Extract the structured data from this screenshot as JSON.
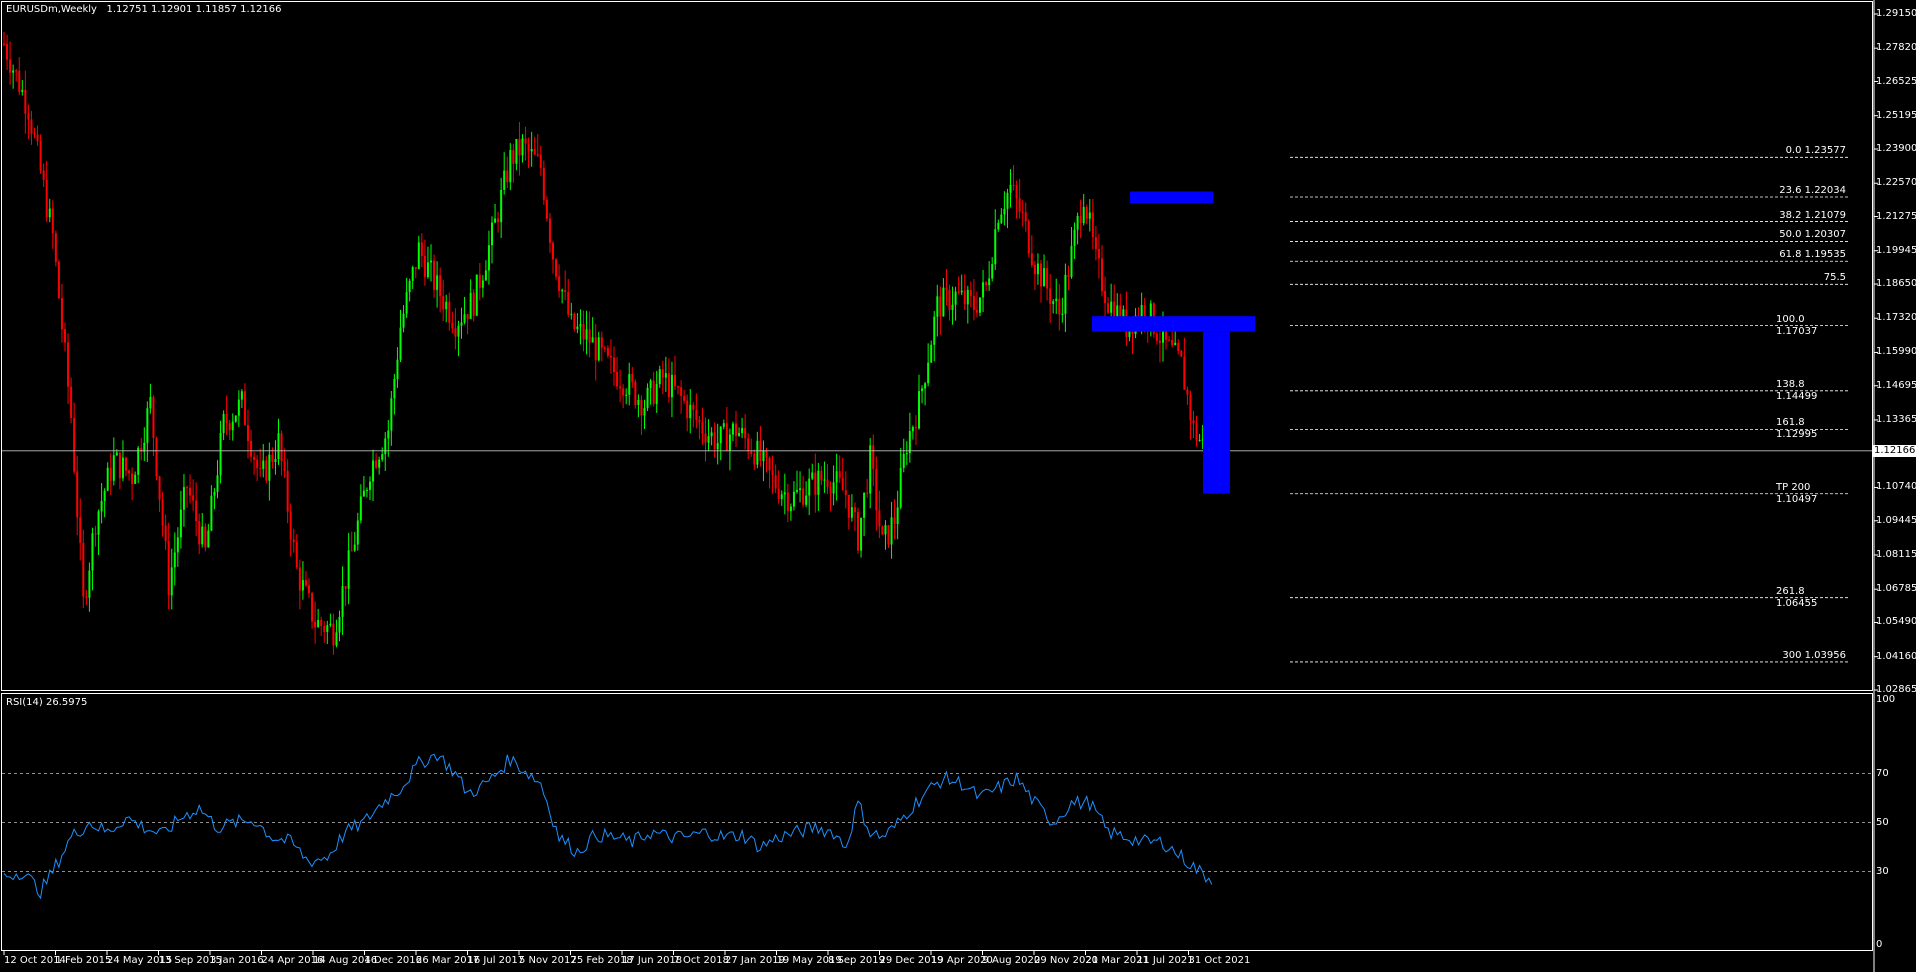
{
  "header": {
    "symbol": "EURUSDm,Weekly",
    "ohlc": "1.12751 1.12901 1.11857 1.12166"
  },
  "rsi_header": "RSI(14) 26.5975",
  "colors": {
    "background": "#000000",
    "bull_candle": "#00ff00",
    "bear_candle": "#ff0000",
    "rsi_line": "#1e90ff",
    "fib_line": "#ffffff",
    "zone": "#0000ff"
  },
  "price_axis": [
    "1.29150",
    "1.27820",
    "1.26525",
    "1.25195",
    "1.23900",
    "1.22570",
    "1.21275",
    "1.19945",
    "1.18650",
    "1.17320",
    "1.15990",
    "1.14695",
    "1.13365",
    "1.10740",
    "1.09445",
    "1.08115",
    "1.06785",
    "1.05490",
    "1.04160",
    "1.02865"
  ],
  "current_price": "1.12166",
  "fib_levels": [
    {
      "label": "0.0 1.23577",
      "price": 1.23577
    },
    {
      "label": "23.6 1.22034",
      "price": 1.22034
    },
    {
      "label": "38.2 1.21079",
      "price": 1.21079
    },
    {
      "label": "50.0 1.20307",
      "price": 1.20307
    },
    {
      "label": "61.8 1.19535",
      "price": 1.19535
    },
    {
      "label": "75.5",
      "price": 1.1864
    },
    {
      "label": "100.0 1.17037",
      "price": 1.17037
    },
    {
      "label": "138.8 1.14499",
      "price": 1.14499
    },
    {
      "label": "161.8 1.12995",
      "price": 1.12995
    },
    {
      "label": "TP 200 1.10497",
      "price": 1.10497
    },
    {
      "label": "261.8 1.06455",
      "price": 1.06455
    },
    {
      "label": "300 1.03956",
      "price": 1.03956
    }
  ],
  "rsi_axis": [
    "100",
    "70",
    "50",
    "30",
    "0"
  ],
  "date_axis": [
    "12 Oct 2014",
    "1 Feb 2015",
    "24 May 2015",
    "13 Sep 2015",
    "3 Jan 2016",
    "24 Apr 2016",
    "14 Aug 2016",
    "4 Dec 2016",
    "26 Mar 2017",
    "16 Jul 2017",
    "5 Nov 2017",
    "25 Feb 2018",
    "17 Jun 2018",
    "7 Oct 2018",
    "27 Jan 2019",
    "19 May 2019",
    "8 Sep 2019",
    "29 Dec 2019",
    "19 Apr 2020",
    "9 Aug 2020",
    "29 Nov 2020",
    "21 Mar 2021",
    "11 Jul 2021",
    "31 Oct 2021"
  ],
  "chart_data": {
    "type": "candlestick",
    "timeframe": "weekly",
    "ylim": [
      1.02865,
      1.2915
    ],
    "series_key": [
      [
        0,
        1.28
      ],
      [
        8,
        1.255
      ],
      [
        16,
        1.205
      ],
      [
        22,
        1.135
      ],
      [
        26,
        1.062
      ],
      [
        30,
        1.095
      ],
      [
        36,
        1.118
      ],
      [
        42,
        1.112
      ],
      [
        48,
        1.14
      ],
      [
        54,
        1.07
      ],
      [
        60,
        1.108
      ],
      [
        66,
        1.082
      ],
      [
        72,
        1.132
      ],
      [
        78,
        1.14
      ],
      [
        84,
        1.11
      ],
      [
        90,
        1.125
      ],
      [
        96,
        1.075
      ],
      [
        102,
        1.055
      ],
      [
        108,
        1.052
      ],
      [
        114,
        1.082
      ],
      [
        120,
        1.115
      ],
      [
        126,
        1.13
      ],
      [
        130,
        1.17
      ],
      [
        136,
        1.2
      ],
      [
        142,
        1.185
      ],
      [
        148,
        1.172
      ],
      [
        154,
        1.18
      ],
      [
        160,
        1.205
      ],
      [
        166,
        1.235
      ],
      [
        170,
        1.24
      ],
      [
        176,
        1.232
      ],
      [
        180,
        1.198
      ],
      [
        186,
        1.17
      ],
      [
        192,
        1.165
      ],
      [
        198,
        1.155
      ],
      [
        204,
        1.148
      ],
      [
        210,
        1.14
      ],
      [
        216,
        1.15
      ],
      [
        222,
        1.142
      ],
      [
        228,
        1.132
      ],
      [
        234,
        1.125
      ],
      [
        240,
        1.13
      ],
      [
        246,
        1.122
      ],
      [
        252,
        1.11
      ],
      [
        258,
        1.103
      ],
      [
        264,
        1.108
      ],
      [
        270,
        1.112
      ],
      [
        276,
        1.105
      ],
      [
        280,
        1.088
      ],
      [
        284,
        1.118
      ],
      [
        288,
        1.085
      ],
      [
        292,
        1.095
      ],
      [
        296,
        1.125
      ],
      [
        300,
        1.14
      ],
      [
        306,
        1.178
      ],
      [
        312,
        1.182
      ],
      [
        318,
        1.178
      ],
      [
        322,
        1.185
      ],
      [
        326,
        1.215
      ],
      [
        330,
        1.224
      ],
      [
        334,
        1.212
      ],
      [
        338,
        1.195
      ],
      [
        342,
        1.185
      ],
      [
        346,
        1.175
      ],
      [
        350,
        1.198
      ],
      [
        354,
        1.222
      ],
      [
        358,
        1.195
      ],
      [
        362,
        1.18
      ],
      [
        368,
        1.17
      ],
      [
        374,
        1.178
      ],
      [
        380,
        1.164
      ],
      [
        386,
        1.155
      ],
      [
        390,
        1.13
      ],
      [
        394,
        1.122
      ]
    ],
    "rsi_key": [
      [
        0,
        28
      ],
      [
        6,
        30
      ],
      [
        12,
        22
      ],
      [
        16,
        30
      ],
      [
        22,
        44
      ],
      [
        28,
        50
      ],
      [
        34,
        46
      ],
      [
        40,
        52
      ],
      [
        46,
        48
      ],
      [
        52,
        45
      ],
      [
        58,
        52
      ],
      [
        64,
        56
      ],
      [
        70,
        48
      ],
      [
        76,
        50
      ],
      [
        82,
        51
      ],
      [
        88,
        44
      ],
      [
        94,
        42
      ],
      [
        100,
        34
      ],
      [
        106,
        36
      ],
      [
        112,
        46
      ],
      [
        118,
        50
      ],
      [
        124,
        58
      ],
      [
        130,
        64
      ],
      [
        136,
        74
      ],
      [
        142,
        78
      ],
      [
        148,
        70
      ],
      [
        152,
        62
      ],
      [
        156,
        64
      ],
      [
        160,
        68
      ],
      [
        166,
        76
      ],
      [
        170,
        72
      ],
      [
        176,
        66
      ],
      [
        182,
        44
      ],
      [
        188,
        38
      ],
      [
        194,
        45
      ],
      [
        200,
        44
      ],
      [
        206,
        42
      ],
      [
        212,
        46
      ],
      [
        218,
        44
      ],
      [
        224,
        44
      ],
      [
        230,
        46
      ],
      [
        236,
        44
      ],
      [
        242,
        45
      ],
      [
        248,
        40
      ],
      [
        254,
        44
      ],
      [
        260,
        46
      ],
      [
        266,
        48
      ],
      [
        272,
        46
      ],
      [
        276,
        40
      ],
      [
        280,
        58
      ],
      [
        284,
        46
      ],
      [
        288,
        44
      ],
      [
        292,
        48
      ],
      [
        296,
        54
      ],
      [
        302,
        62
      ],
      [
        308,
        68
      ],
      [
        314,
        66
      ],
      [
        320,
        60
      ],
      [
        326,
        64
      ],
      [
        332,
        68
      ],
      [
        338,
        58
      ],
      [
        344,
        50
      ],
      [
        350,
        58
      ],
      [
        356,
        58
      ],
      [
        362,
        46
      ],
      [
        368,
        44
      ],
      [
        374,
        42
      ],
      [
        380,
        42
      ],
      [
        386,
        36
      ],
      [
        392,
        30
      ],
      [
        396,
        26.6
      ]
    ],
    "zones": [
      {
        "from_x": 1130,
        "to_x": 1213,
        "price_hi": 1.2225,
        "price_lo": 1.218
      },
      {
        "from_x": 1092,
        "to_x": 1255,
        "price_hi": 1.174,
        "price_lo": 1.168
      },
      {
        "from_x": 1203,
        "to_x": 1230,
        "price_hi": 1.168,
        "price_lo": 1.105
      }
    ]
  }
}
